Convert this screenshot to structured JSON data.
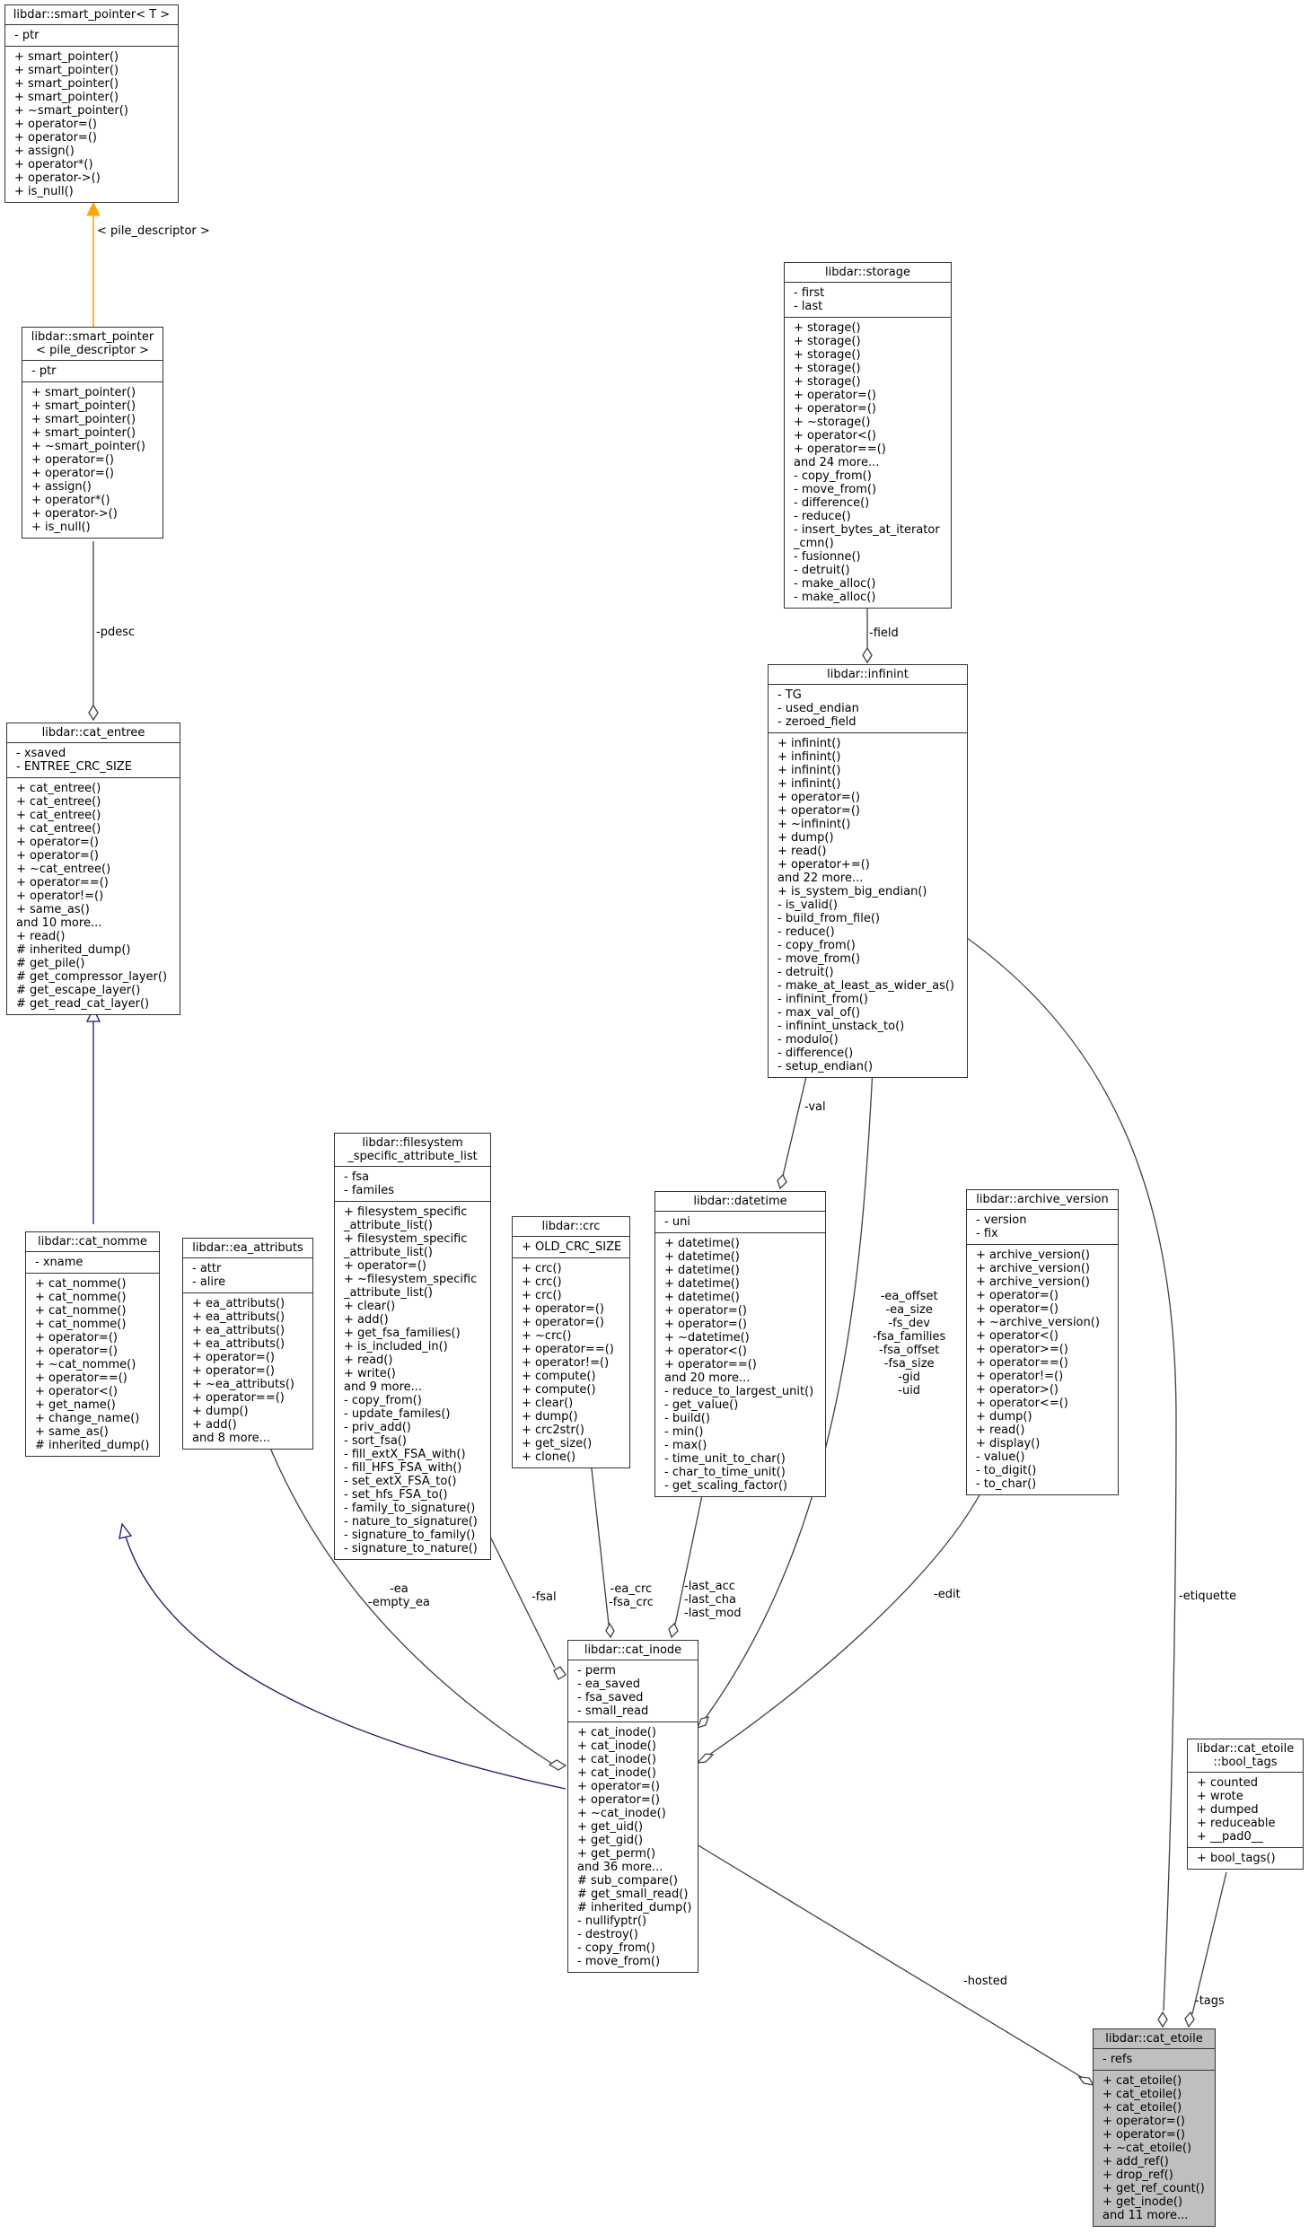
{
  "diagram": {
    "type": "class-collaboration-graph",
    "colors": {
      "inheritance_public": "#191970",
      "template_instance": "#ffa500",
      "usage": "#404040",
      "highlight_fill": "#bfbfbf"
    },
    "classes": {
      "smart_pointer_T": {
        "title": "libdar::smart_pointer< T >",
        "attributes": [
          "- ptr"
        ],
        "methods": [
          "+ smart_pointer()",
          "+ smart_pointer()",
          "+ smart_pointer()",
          "+ smart_pointer()",
          "+ ~smart_pointer()",
          "+ operator=()",
          "+ operator=()",
          "+ assign()",
          "+ operator*()",
          "+ operator->()",
          "+ is_null()"
        ]
      },
      "smart_pointer_pd": {
        "title": "libdar::smart_pointer\n< pile_descriptor >",
        "attributes": [
          "- ptr"
        ],
        "methods": [
          "+ smart_pointer()",
          "+ smart_pointer()",
          "+ smart_pointer()",
          "+ smart_pointer()",
          "+ ~smart_pointer()",
          "+ operator=()",
          "+ operator=()",
          "+ assign()",
          "+ operator*()",
          "+ operator->()",
          "+ is_null()"
        ]
      },
      "cat_entree": {
        "title": "libdar::cat_entree",
        "attributes": [
          "- xsaved",
          "- ENTREE_CRC_SIZE"
        ],
        "methods": [
          "+ cat_entree()",
          "+ cat_entree()",
          "+ cat_entree()",
          "+ cat_entree()",
          "+ operator=()",
          "+ operator=()",
          "+ ~cat_entree()",
          "+ operator==()",
          "+ operator!=()",
          "+ same_as()",
          "and 10 more...",
          "+ read()",
          "# inherited_dump()",
          "# get_pile()",
          "# get_compressor_layer()",
          "# get_escape_layer()",
          "# get_read_cat_layer()"
        ]
      },
      "cat_nomme": {
        "title": "libdar::cat_nomme",
        "attributes": [
          "- xname"
        ],
        "methods": [
          "+ cat_nomme()",
          "+ cat_nomme()",
          "+ cat_nomme()",
          "+ cat_nomme()",
          "+ operator=()",
          "+ operator=()",
          "+ ~cat_nomme()",
          "+ operator==()",
          "+ operator<()",
          "+ get_name()",
          "+ change_name()",
          "+ same_as()",
          "# inherited_dump()"
        ]
      },
      "ea_attributs": {
        "title": "libdar::ea_attributs",
        "attributes": [
          "- attr",
          "- alire"
        ],
        "methods": [
          "+ ea_attributs()",
          "+ ea_attributs()",
          "+ ea_attributs()",
          "+ ea_attributs()",
          "+ operator=()",
          "+ operator=()",
          "+ ~ea_attributs()",
          "+ operator==()",
          "+ dump()",
          "+ add()",
          "and 8 more..."
        ]
      },
      "fsa_list": {
        "title": "libdar::filesystem\n_specific_attribute_list",
        "attributes": [
          "- fsa",
          "- familes"
        ],
        "methods": [
          "+ filesystem_specific",
          "_attribute_list()",
          "+ filesystem_specific",
          "_attribute_list()",
          "+ operator=()",
          "+ ~filesystem_specific",
          "_attribute_list()",
          "+ clear()",
          "+ add()",
          "+ get_fsa_families()",
          "+ is_included_in()",
          "+ read()",
          "+ write()",
          "and 9 more...",
          "- copy_from()",
          "- update_familes()",
          "- priv_add()",
          "- sort_fsa()",
          "- fill_extX_FSA_with()",
          "- fill_HFS_FSA_with()",
          "- set_extX_FSA_to()",
          "- set_hfs_FSA_to()",
          "- family_to_signature()",
          "- nature_to_signature()",
          "- signature_to_family()",
          "- signature_to_nature()"
        ]
      },
      "crc": {
        "title": "libdar::crc",
        "attributes": [
          "+ OLD_CRC_SIZE"
        ],
        "methods": [
          "+ crc()",
          "+ crc()",
          "+ crc()",
          "+ operator=()",
          "+ operator=()",
          "+ ~crc()",
          "+ operator==()",
          "+ operator!=()",
          "+ compute()",
          "+ compute()",
          "+ clear()",
          "+ dump()",
          "+ crc2str()",
          "+ get_size()",
          "+ clone()"
        ]
      },
      "datetime": {
        "title": "libdar::datetime",
        "attributes": [
          "- uni"
        ],
        "methods": [
          "+ datetime()",
          "+ datetime()",
          "+ datetime()",
          "+ datetime()",
          "+ datetime()",
          "+ operator=()",
          "+ operator=()",
          "+ ~datetime()",
          "+ operator<()",
          "+ operator==()",
          "and 20 more...",
          "- reduce_to_largest_unit()",
          "- get_value()",
          "- build()",
          "- min()",
          "- max()",
          "- time_unit_to_char()",
          "- char_to_time_unit()",
          "- get_scaling_factor()"
        ]
      },
      "storage": {
        "title": "libdar::storage",
        "attributes": [
          "- first",
          "- last"
        ],
        "methods": [
          "+ storage()",
          "+ storage()",
          "+ storage()",
          "+ storage()",
          "+ storage()",
          "+ operator=()",
          "+ operator=()",
          "+ ~storage()",
          "+ operator<()",
          "+ operator==()",
          "and 24 more...",
          "- copy_from()",
          "- move_from()",
          "- difference()",
          "- reduce()",
          "- insert_bytes_at_iterator",
          "_cmn()",
          "- fusionne()",
          "- detruit()",
          "- make_alloc()",
          "- make_alloc()"
        ]
      },
      "infinint": {
        "title": "libdar::infinint",
        "attributes": [
          "- TG",
          "- used_endian",
          "- zeroed_field"
        ],
        "methods": [
          "+ infinint()",
          "+ infinint()",
          "+ infinint()",
          "+ infinint()",
          "+ operator=()",
          "+ operator=()",
          "+ ~infinint()",
          "+ dump()",
          "+ read()",
          "+ operator+=()",
          "and 22 more...",
          "+ is_system_big_endian()",
          "- is_valid()",
          "- build_from_file()",
          "- reduce()",
          "- copy_from()",
          "- move_from()",
          "- detruit()",
          "- make_at_least_as_wider_as()",
          "- infinint_from()",
          "- max_val_of()",
          "- infinint_unstack_to()",
          "- modulo()",
          "- difference()",
          "- setup_endian()"
        ]
      },
      "archive_version": {
        "title": "libdar::archive_version",
        "attributes": [
          "- version",
          "- fix"
        ],
        "methods": [
          "+ archive_version()",
          "+ archive_version()",
          "+ archive_version()",
          "+ operator=()",
          "+ operator=()",
          "+ ~archive_version()",
          "+ operator<()",
          "+ operator>=()",
          "+ operator==()",
          "+ operator!=()",
          "+ operator>()",
          "+ operator<=()",
          "+ dump()",
          "+ read()",
          "+ display()",
          "- value()",
          "- to_digit()",
          "- to_char()"
        ]
      },
      "cat_inode": {
        "title": "libdar::cat_inode",
        "attributes": [
          "- perm",
          "- ea_saved",
          "- fsa_saved",
          "- small_read"
        ],
        "methods": [
          "+ cat_inode()",
          "+ cat_inode()",
          "+ cat_inode()",
          "+ cat_inode()",
          "+ operator=()",
          "+ operator=()",
          "+ ~cat_inode()",
          "+ get_uid()",
          "+ get_gid()",
          "+ get_perm()",
          "and 36 more...",
          "# sub_compare()",
          "# get_small_read()",
          "# inherited_dump()",
          "- nullifyptr()",
          "- destroy()",
          "- copy_from()",
          "- move_from()"
        ]
      },
      "bool_tags": {
        "title": "libdar::cat_etoile\n::bool_tags",
        "attributes": [
          "+ counted",
          "+ wrote",
          "+ dumped",
          "+ reduceable",
          "+ __pad0__"
        ],
        "methods": [
          "+ bool_tags()"
        ]
      },
      "cat_etoile": {
        "title": "libdar::cat_etoile",
        "attributes": [
          "- refs"
        ],
        "methods": [
          "+ cat_etoile()",
          "+ cat_etoile()",
          "+ cat_etoile()",
          "+ operator=()",
          "+ operator=()",
          "+ ~cat_etoile()",
          "+ add_ref()",
          "+ drop_ref()",
          "+ get_ref_count()",
          "+ get_inode()",
          "and 11 more..."
        ]
      }
    },
    "edge_labels": {
      "template": "< pile_descriptor >",
      "pdesc": "-pdesc",
      "field": "-field",
      "val": "-val",
      "ea": "-ea\n-empty_ea",
      "fsal": "-fsal",
      "crc": "-ea_crc\n-fsa_crc",
      "dates": "-last_acc\n-last_cha\n-last_mod",
      "infinint_members": "-ea_offset\n-ea_size\n-fs_dev\n-fsa_families\n-fsa_offset\n-fsa_size\n-gid\n-uid",
      "edit": "-edit",
      "etiquette": "-etiquette",
      "hosted": "-hosted",
      "tags": "-tags"
    }
  }
}
